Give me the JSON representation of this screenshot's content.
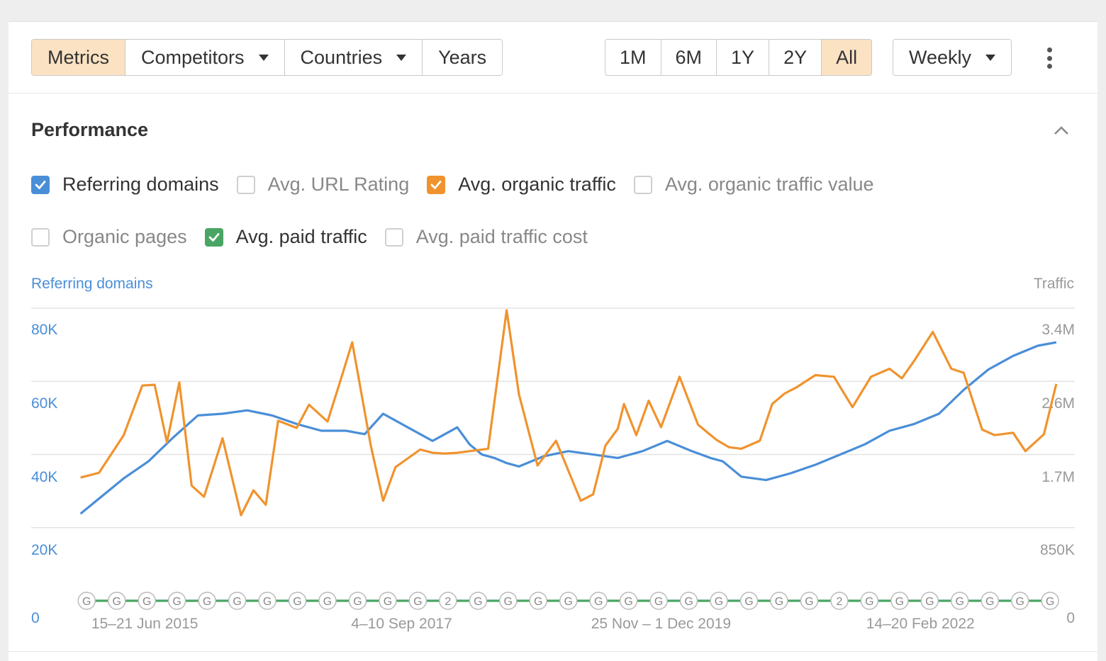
{
  "toolbar": {
    "left_buttons": [
      {
        "label": "Metrics",
        "active": true,
        "dropdown": false
      },
      {
        "label": "Competitors",
        "active": false,
        "dropdown": true
      },
      {
        "label": "Countries",
        "active": false,
        "dropdown": true
      },
      {
        "label": "Years",
        "active": false,
        "dropdown": false
      }
    ],
    "range_buttons": [
      {
        "label": "1M",
        "active": false
      },
      {
        "label": "6M",
        "active": false
      },
      {
        "label": "1Y",
        "active": false
      },
      {
        "label": "2Y",
        "active": false
      },
      {
        "label": "All",
        "active": true
      }
    ],
    "interval": {
      "label": "Weekly"
    }
  },
  "panel": {
    "title": "Performance"
  },
  "checkboxes": [
    {
      "label": "Referring domains",
      "checked": true,
      "color": "#4a8ed8"
    },
    {
      "label": "Avg. URL Rating",
      "checked": false,
      "color": ""
    },
    {
      "label": "Avg. organic traffic",
      "checked": true,
      "color": "#f0932e"
    },
    {
      "label": "Avg. organic traffic value",
      "checked": false,
      "color": ""
    },
    {
      "label": "Organic pages",
      "checked": false,
      "color": ""
    },
    {
      "label": "Avg. paid traffic",
      "checked": true,
      "color": "#4aa564"
    },
    {
      "label": "Avg. paid traffic cost",
      "checked": false,
      "color": ""
    }
  ],
  "colors": {
    "accent": "#fbe2c3",
    "blue": "#4a8ed8",
    "orange": "#f0932e",
    "green": "#4aa564",
    "grid": "#e3e3e3"
  },
  "chart_data": {
    "type": "line",
    "left_axis_title": "Referring domains",
    "right_axis_title": "Traffic",
    "left_ticks": [
      "80K",
      "60K",
      "40K",
      "20K",
      "0"
    ],
    "right_ticks": [
      "3.4M",
      "2.6M",
      "1.7M",
      "850K",
      "0"
    ],
    "ylim_left": [
      0,
      80000
    ],
    "ylim_right": [
      0,
      3400000
    ],
    "x_labels": [
      "15–21 Jun 2015",
      "4–10 Sep 2017",
      "25 Nov – 1 Dec 2019",
      "14–20 Feb 2022"
    ],
    "x_domain": [
      2015.2,
      2023.5
    ],
    "grid": true,
    "series": [
      {
        "name": "Referring domains",
        "axis": "left",
        "color": "#4a8ed8",
        "x": [
          2015.45,
          2015.8,
          2016.0,
          2016.2,
          2016.4,
          2016.6,
          2016.8,
          2017.0,
          2017.2,
          2017.4,
          2017.6,
          2017.75,
          2017.9,
          2018.1,
          2018.3,
          2018.5,
          2018.6,
          2018.7,
          2018.8,
          2018.9,
          2019.0,
          2019.2,
          2019.4,
          2019.6,
          2019.8,
          2020.0,
          2020.2,
          2020.4,
          2020.55,
          2020.65,
          2020.8,
          2021.0,
          2021.2,
          2021.4,
          2021.6,
          2021.8,
          2022.0,
          2022.2,
          2022.4,
          2022.6,
          2022.8,
          2023.0,
          2023.2,
          2023.35
        ],
        "values": [
          25600,
          36000,
          41000,
          48000,
          54500,
          55000,
          56000,
          54500,
          52000,
          50000,
          50000,
          49000,
          55000,
          51000,
          47000,
          51000,
          46000,
          43000,
          42000,
          40500,
          39500,
          42500,
          44000,
          43000,
          42000,
          44000,
          47000,
          44000,
          42000,
          41000,
          36500,
          35500,
          37500,
          40000,
          43000,
          46000,
          50000,
          52000,
          55000,
          62000,
          68000,
          72000,
          75000,
          76000
        ]
      },
      {
        "name": "Avg. organic traffic",
        "axis": "right",
        "color": "#f0932e",
        "x": [
          2015.45,
          2015.6,
          2015.8,
          2015.95,
          2016.05,
          2016.15,
          2016.25,
          2016.35,
          2016.45,
          2016.6,
          2016.75,
          2016.85,
          2016.95,
          2017.05,
          2017.2,
          2017.3,
          2017.45,
          2017.55,
          2017.65,
          2017.8,
          2017.9,
          2018.0,
          2018.1,
          2018.2,
          2018.3,
          2018.4,
          2018.5,
          2018.6,
          2018.75,
          2018.9,
          2019.0,
          2019.15,
          2019.3,
          2019.5,
          2019.6,
          2019.7,
          2019.8,
          2019.85,
          2019.95,
          2020.05,
          2020.15,
          2020.3,
          2020.45,
          2020.6,
          2020.7,
          2020.8,
          2020.95,
          2021.05,
          2021.15,
          2021.25,
          2021.4,
          2021.55,
          2021.7,
          2021.85,
          2022.0,
          2022.1,
          2022.2,
          2022.35,
          2022.5,
          2022.6,
          2022.75,
          2022.85,
          2023.0,
          2023.1,
          2023.25,
          2023.35
        ],
        "values": [
          1540000,
          1600000,
          2070000,
          2690000,
          2700000,
          1980000,
          2730000,
          1440000,
          1300000,
          2030000,
          1070000,
          1380000,
          1200000,
          2250000,
          2160000,
          2450000,
          2240000,
          2730000,
          3230000,
          1940000,
          1250000,
          1670000,
          1780000,
          1890000,
          1850000,
          1840000,
          1850000,
          1870000,
          1900000,
          3630000,
          2580000,
          1690000,
          2000000,
          1250000,
          1330000,
          1940000,
          2150000,
          2460000,
          2070000,
          2500000,
          2170000,
          2800000,
          2200000,
          2010000,
          1920000,
          1900000,
          2000000,
          2460000,
          2590000,
          2670000,
          2820000,
          2800000,
          2420000,
          2800000,
          2900000,
          2780000,
          3000000,
          3360000,
          2900000,
          2850000,
          2140000,
          2070000,
          2100000,
          1870000,
          2080000,
          2710000
        ]
      },
      {
        "name": "Avg. paid traffic",
        "axis": "right",
        "color": "#4aa564",
        "x": [
          2015.45,
          2023.35
        ],
        "values": [
          0,
          0
        ]
      }
    ],
    "annotations": [
      "G",
      "G",
      "G",
      "G",
      "G",
      "G",
      "G",
      "G",
      "G",
      "G",
      "G",
      "G",
      "2",
      "G",
      "G",
      "G",
      "G",
      "G",
      "G",
      "G",
      "G",
      "G",
      "G",
      "G",
      "G",
      "2",
      "G",
      "G",
      "G",
      "G",
      "G",
      "G",
      "G"
    ]
  }
}
